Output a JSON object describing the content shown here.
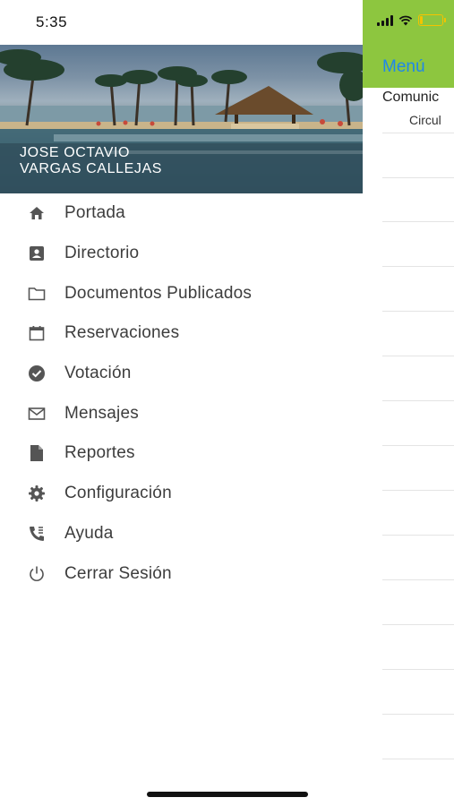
{
  "status_bar": {
    "time": "5:35"
  },
  "user": {
    "name_line1": "JOSE OCTAVIO",
    "name_line2": "VARGAS CALLEJAS"
  },
  "menu": {
    "items": [
      {
        "label": "Portada",
        "icon": "home-icon"
      },
      {
        "label": "Directorio",
        "icon": "contact-card-icon"
      },
      {
        "label": "Documentos Publicados",
        "icon": "folder-icon"
      },
      {
        "label": "Reservaciones",
        "icon": "calendar-icon"
      },
      {
        "label": "Votación",
        "icon": "check-circle-icon"
      },
      {
        "label": "Mensajes",
        "icon": "envelope-icon"
      },
      {
        "label": "Reportes",
        "icon": "document-icon"
      },
      {
        "label": "Configuración",
        "icon": "gear-icon"
      },
      {
        "label": "Ayuda",
        "icon": "phone-icon"
      },
      {
        "label": "Cerrar Sesión",
        "icon": "power-icon"
      }
    ]
  },
  "background_screen": {
    "title": "Menú",
    "row1": "Comunic",
    "row2": "Circul"
  },
  "colors": {
    "header_green": "#8dc63f",
    "title_blue": "#1f87ea",
    "battery_yellow": "#f3c300",
    "icon_gray": "#555555"
  },
  "battery_level": 0.15
}
